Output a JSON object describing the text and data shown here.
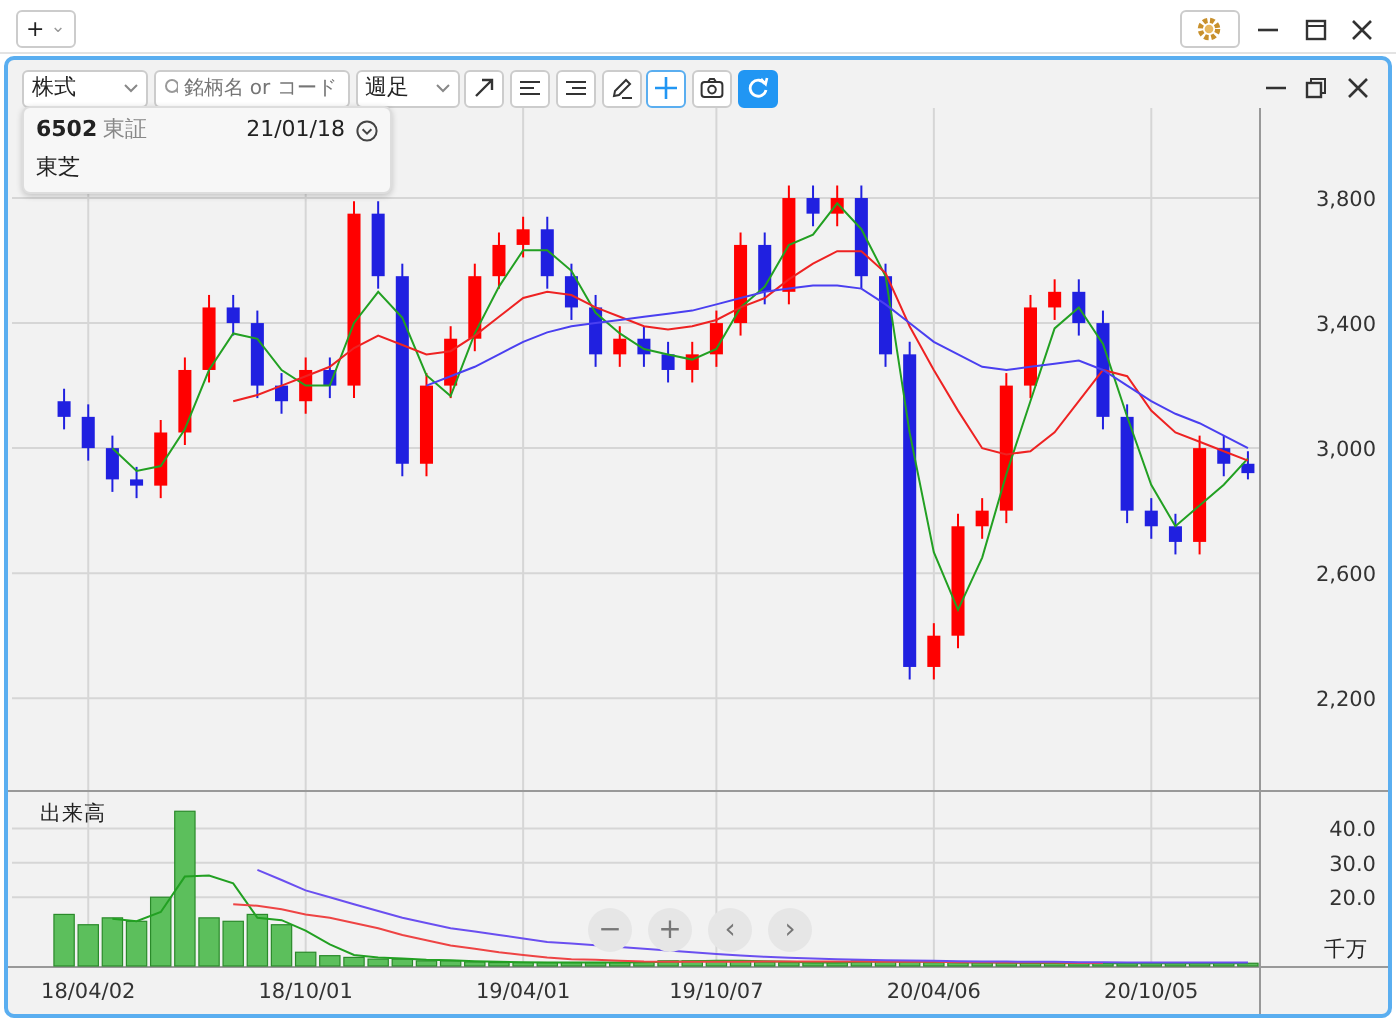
{
  "app_bar": {
    "add_button": "+",
    "caret": "⌄"
  },
  "toolbar": {
    "category": "株式",
    "search": {
      "placeholder": "銘柄名 or コード"
    },
    "period": "週足",
    "tools": [
      {
        "kind": "trend-line",
        "selected": false
      },
      {
        "kind": "align-left",
        "selected": false
      },
      {
        "kind": "align-right",
        "selected": false
      },
      {
        "kind": "pencil",
        "selected": false
      },
      {
        "kind": "crosshair",
        "selected": true
      },
      {
        "kind": "camera",
        "selected": false
      },
      {
        "kind": "refresh",
        "selected": true
      }
    ]
  },
  "info": {
    "code": "6502",
    "market": "東証",
    "date": "21/01/18",
    "name": "東芝"
  },
  "price_chart": {
    "chart_data": {
      "type": "candlestick",
      "grid": true,
      "categories": [
        null,
        null,
        null,
        null,
        null,
        null,
        null,
        null,
        null,
        null,
        null,
        null,
        null,
        null,
        null,
        null,
        null,
        null,
        null,
        null,
        null,
        null,
        null,
        null,
        null,
        null,
        null,
        null,
        null,
        null,
        null,
        null,
        null,
        null,
        null,
        null,
        null,
        null,
        null,
        null,
        null,
        null,
        null,
        null,
        null,
        null,
        null,
        null,
        null,
        null
      ],
      "ylim": [
        1900,
        4088
      ],
      "yticks": [
        {
          "value": 3800,
          "label": "3,800"
        },
        {
          "value": 3400,
          "label": "3,400"
        },
        {
          "value": 3000,
          "label": "3,000"
        },
        {
          "value": 2600,
          "label": "2,600"
        },
        {
          "value": 2200,
          "label": "2,200"
        }
      ],
      "ohlc": [
        [
          3150,
          3190,
          3060,
          3100
        ],
        [
          3100,
          3140,
          2960,
          3000
        ],
        [
          3000,
          3040,
          2860,
          2900
        ],
        [
          2900,
          2940,
          2840,
          2880
        ],
        [
          2880,
          3090,
          2840,
          3050
        ],
        [
          3050,
          3290,
          3010,
          3250
        ],
        [
          3250,
          3490,
          3210,
          3450
        ],
        [
          3450,
          3490,
          3360,
          3400
        ],
        [
          3400,
          3440,
          3160,
          3200
        ],
        [
          3200,
          3240,
          3110,
          3150
        ],
        [
          3150,
          3290,
          3110,
          3250
        ],
        [
          3250,
          3290,
          3160,
          3200
        ],
        [
          3200,
          3790,
          3160,
          3750
        ],
        [
          3750,
          3790,
          3510,
          3550
        ],
        [
          3550,
          3590,
          2910,
          2950
        ],
        [
          2950,
          3240,
          2910,
          3200
        ],
        [
          3200,
          3390,
          3160,
          3350
        ],
        [
          3350,
          3590,
          3310,
          3550
        ],
        [
          3550,
          3690,
          3510,
          3650
        ],
        [
          3650,
          3740,
          3610,
          3700
        ],
        [
          3700,
          3740,
          3510,
          3550
        ],
        [
          3550,
          3590,
          3410,
          3450
        ],
        [
          3450,
          3490,
          3260,
          3300
        ],
        [
          3300,
          3390,
          3260,
          3350
        ],
        [
          3350,
          3390,
          3260,
          3300
        ],
        [
          3300,
          3340,
          3210,
          3250
        ],
        [
          3250,
          3340,
          3210,
          3300
        ],
        [
          3300,
          3440,
          3260,
          3400
        ],
        [
          3400,
          3690,
          3360,
          3650
        ],
        [
          3650,
          3690,
          3460,
          3500
        ],
        [
          3500,
          3840,
          3460,
          3800
        ],
        [
          3800,
          3840,
          3710,
          3750
        ],
        [
          3750,
          3840,
          3710,
          3800
        ],
        [
          3800,
          3840,
          3510,
          3550
        ],
        [
          3550,
          3590,
          3260,
          3300
        ],
        [
          3300,
          3340,
          2260,
          2300
        ],
        [
          2300,
          2440,
          2260,
          2400
        ],
        [
          2400,
          2790,
          2360,
          2750
        ],
        [
          2750,
          2840,
          2710,
          2800
        ],
        [
          2800,
          3240,
          2760,
          3200
        ],
        [
          3200,
          3490,
          3160,
          3450
        ],
        [
          3450,
          3540,
          3410,
          3500
        ],
        [
          3500,
          3540,
          3360,
          3400
        ],
        [
          3400,
          3440,
          3060,
          3100
        ],
        [
          3100,
          3140,
          2760,
          2800
        ],
        [
          2800,
          2840,
          2710,
          2750
        ],
        [
          2750,
          2790,
          2660,
          2700
        ],
        [
          2700,
          3040,
          2660,
          3000
        ],
        [
          3000,
          3040,
          2910,
          2950
        ],
        [
          2950,
          2990,
          2900,
          2920
        ]
      ],
      "series": [
        {
          "type": "line",
          "color": "#22a022",
          "values": [
            null,
            null,
            3000,
            2927,
            2943,
            3060,
            3250,
            3367,
            3350,
            3250,
            3200,
            3200,
            3400,
            3500,
            3417,
            3233,
            3167,
            3367,
            3517,
            3633,
            3633,
            3567,
            3433,
            3367,
            3317,
            3300,
            3283,
            3317,
            3450,
            3517,
            3650,
            3683,
            3783,
            3700,
            3550,
            3050,
            2667,
            2483,
            2650,
            2917,
            3150,
            3383,
            3450,
            3333,
            3100,
            2883,
            2750,
            2817,
            2883,
            2967
          ]
        },
        {
          "type": "line",
          "color": "#ee2222",
          "values": [
            null,
            null,
            null,
            null,
            null,
            null,
            null,
            3150,
            3170,
            3200,
            3230,
            3260,
            3320,
            3360,
            3330,
            3300,
            3310,
            3360,
            3420,
            3480,
            3500,
            3490,
            3450,
            3420,
            3390,
            3380,
            3390,
            3410,
            3450,
            3480,
            3540,
            3590,
            3630,
            3630,
            3560,
            3390,
            3250,
            3120,
            3000,
            2980,
            2990,
            3050,
            3150,
            3250,
            3230,
            3120,
            3050,
            3020,
            2990,
            2960
          ]
        },
        {
          "type": "line",
          "color": "#4a3ff0",
          "values": [
            null,
            null,
            null,
            null,
            null,
            null,
            null,
            null,
            null,
            null,
            null,
            null,
            null,
            null,
            null,
            3200,
            3230,
            3260,
            3300,
            3340,
            3370,
            3390,
            3400,
            3410,
            3420,
            3430,
            3440,
            3460,
            3480,
            3500,
            3510,
            3520,
            3520,
            3510,
            3460,
            3400,
            3340,
            3300,
            3260,
            3250,
            3260,
            3270,
            3280,
            3250,
            3200,
            3150,
            3110,
            3080,
            3040,
            3000
          ]
        }
      ]
    }
  },
  "volume_chart": {
    "title": "出来高",
    "unit": "千万",
    "chart_data": {
      "type": "bar",
      "grid": true,
      "categories": [
        null,
        "18/04/02",
        null,
        null,
        null,
        null,
        null,
        null,
        null,
        null,
        "18/10/01",
        null,
        null,
        null,
        null,
        null,
        null,
        null,
        null,
        "19/04/01",
        null,
        null,
        null,
        null,
        null,
        null,
        null,
        "19/10/07",
        null,
        null,
        null,
        null,
        null,
        null,
        null,
        null,
        "20/04/06",
        null,
        null,
        null,
        null,
        null,
        null,
        null,
        null,
        "20/10/05",
        null,
        null,
        null,
        null
      ],
      "ylim": [
        0,
        50.6
      ],
      "yticks": [
        {
          "value": 40,
          "label": "40.0"
        },
        {
          "value": 30,
          "label": "30.0"
        },
        {
          "value": 20,
          "label": "20.0"
        }
      ],
      "series": [
        {
          "color": "#5cbf5c",
          "values": [
            15,
            12,
            14,
            13,
            20,
            45,
            14,
            13,
            15,
            12,
            4,
            3,
            2.5,
            2,
            2,
            1.5,
            1.5,
            1.2,
            1,
            1,
            1,
            1,
            1,
            1,
            1.2,
            1.5,
            1.5,
            1.5,
            1.5,
            1.2,
            1,
            1,
            1,
            1.5,
            1.5,
            1.2,
            1,
            1,
            1,
            1,
            0.8,
            0.8,
            0.8,
            0.8,
            0.8,
            0.8,
            0.8,
            0.8,
            0.8,
            0.8
          ]
        },
        {
          "type": "line",
          "color": "#22a022",
          "values": [
            null,
            null,
            13.7,
            13,
            15.7,
            26,
            26.3,
            24,
            14,
            13.3,
            10.3,
            6.3,
            3.2,
            2.5,
            2.2,
            1.8,
            1.7,
            1.4,
            1.2,
            1.1,
            1,
            1,
            1,
            1,
            1.1,
            1.2,
            1.4,
            1.5,
            1.5,
            1.4,
            1.2,
            1,
            1,
            1.2,
            1.3,
            1.4,
            1.2,
            1.1,
            1,
            1,
            0.9,
            0.9,
            0.8,
            0.8,
            0.8,
            0.8,
            0.8,
            0.8,
            0.8,
            0.8
          ]
        },
        {
          "type": "line",
          "color": "#ee4444",
          "values": [
            null,
            null,
            null,
            null,
            null,
            null,
            null,
            18,
            17.5,
            16.5,
            15,
            14,
            12.5,
            11,
            9,
            7.5,
            6,
            5,
            4,
            3.2,
            2.5,
            2,
            1.8,
            1.5,
            1.3,
            1.2,
            1.2,
            1.2,
            1.2,
            1.3,
            1.3,
            1.3,
            1.3,
            1.3,
            1.2,
            1.2,
            1.2,
            1.1,
            1.1,
            1,
            1,
            1,
            0.9,
            0.9,
            null,
            null,
            null,
            null,
            null,
            null
          ]
        },
        {
          "type": "line",
          "color": "#6a4ff0",
          "values": [
            null,
            null,
            null,
            null,
            null,
            null,
            null,
            null,
            28,
            25,
            22,
            20,
            18,
            16,
            14,
            12.5,
            11,
            10,
            9,
            8,
            7,
            6.5,
            null,
            null,
            5,
            4.5,
            4,
            3.5,
            3,
            2.7,
            2.4,
            2.2,
            2,
            1.8,
            1.7,
            1.6,
            1.5,
            1.4,
            1.3,
            1.3,
            1.2,
            1.2,
            1.1,
            1.1,
            1,
            1,
            1,
            1,
            1,
            1
          ]
        }
      ]
    }
  },
  "nav_buttons": [
    "−",
    "+",
    "‹",
    "›"
  ]
}
